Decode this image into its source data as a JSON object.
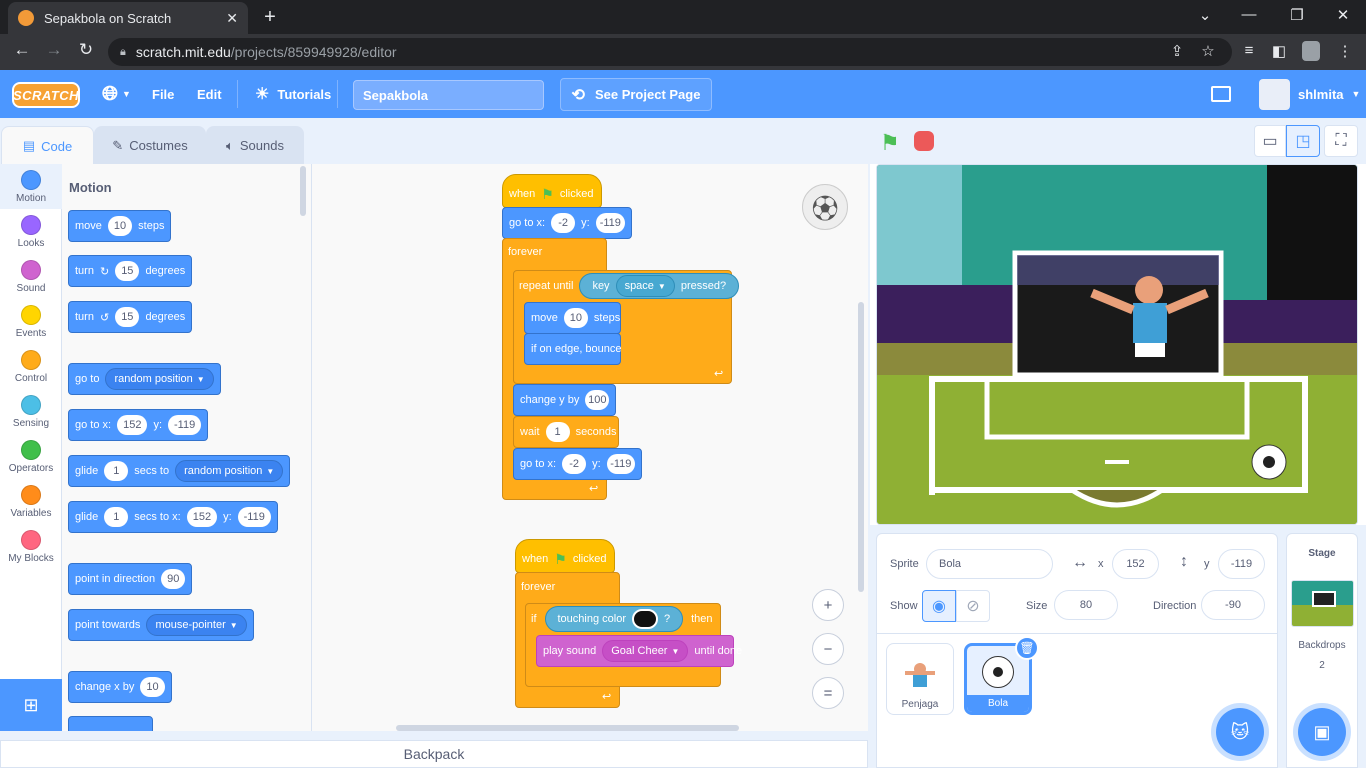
{
  "browser": {
    "tab_title": "Sepakbola on Scratch",
    "tab_close": "✕",
    "new_tab": "+",
    "url_host": "scratch.mit.edu",
    "url_path": "/projects/859949928/editor"
  },
  "menubar": {
    "logo": "SCRATCH",
    "file": "File",
    "edit": "Edit",
    "tutorials": "Tutorials",
    "project_title": "Sepakbola",
    "see_project_page": "See Project Page",
    "username": "shlmita"
  },
  "editor_tabs": {
    "code": "Code",
    "costumes": "Costumes",
    "sounds": "Sounds"
  },
  "categories": [
    {
      "label": "Motion",
      "color": "#4c97ff"
    },
    {
      "label": "Looks",
      "color": "#9966ff"
    },
    {
      "label": "Sound",
      "color": "#cf63cf"
    },
    {
      "label": "Events",
      "color": "#ffd500"
    },
    {
      "label": "Control",
      "color": "#ffab19"
    },
    {
      "label": "Sensing",
      "color": "#4cbfe6"
    },
    {
      "label": "Operators",
      "color": "#40bf4a"
    },
    {
      "label": "Variables",
      "color": "#ff8c1a"
    },
    {
      "label": "My Blocks",
      "color": "#ff6680"
    }
  ],
  "palette": {
    "heading": "Motion",
    "move": {
      "a": "move",
      "v": "10",
      "b": "steps"
    },
    "turn_right": {
      "a": "turn",
      "v": "15",
      "b": "degrees"
    },
    "turn_left": {
      "a": "turn",
      "v": "15",
      "b": "degrees"
    },
    "goto_random": {
      "a": "go to",
      "d": "random position"
    },
    "goto_xy": {
      "a": "go to x:",
      "x": "152",
      "b": "y:",
      "y": "-119"
    },
    "glide_random": {
      "a": "glide",
      "v": "1",
      "b": "secs to",
      "d": "random position"
    },
    "glide_xy": {
      "a": "glide",
      "v": "1",
      "b": "secs to x:",
      "x": "152",
      "c": "y:",
      "y": "-119"
    },
    "point_dir": {
      "a": "point in direction",
      "v": "90"
    },
    "point_towards": {
      "a": "point towards",
      "d": "mouse-pointer"
    },
    "change_x": {
      "a": "change x by",
      "v": "10"
    }
  },
  "script1": {
    "when": "when",
    "clicked": "clicked",
    "goto": {
      "a": "go to x:",
      "x": "-2",
      "b": "y:",
      "y": "-119"
    },
    "forever": "forever",
    "repeat_until": "repeat until",
    "key": "key",
    "key_val": "space",
    "pressed": "pressed?",
    "move": {
      "a": "move",
      "v": "10",
      "b": "steps"
    },
    "bounce": "if on edge, bounce",
    "change_y": {
      "a": "change y by",
      "v": "100"
    },
    "wait": {
      "a": "wait",
      "v": "1",
      "b": "seconds"
    },
    "goto2": {
      "a": "go to x:",
      "x": "-2",
      "b": "y:",
      "y": "-119"
    }
  },
  "script2": {
    "when": "when",
    "clicked": "clicked",
    "forever": "forever",
    "if": "if",
    "touching": "touching color",
    "q": "?",
    "then": "then",
    "play": "play sound",
    "sound": "Goal Cheer",
    "until": "until done"
  },
  "zoom": {
    "in": "+",
    "out": "−",
    "reset": "="
  },
  "backpack": "Backpack",
  "sprite_info": {
    "sprite_label": "Sprite",
    "sprite_name": "Bola",
    "x_label": "x",
    "x": "152",
    "y_label": "y",
    "y": "-119",
    "show_label": "Show",
    "size_label": "Size",
    "size": "80",
    "direction_label": "Direction",
    "direction": "-90"
  },
  "sprites": [
    {
      "name": "Penjaga"
    },
    {
      "name": "Bola"
    }
  ],
  "stage_panel": {
    "title": "Stage",
    "backdrops_label": "Backdrops",
    "backdrops_count": "2"
  }
}
